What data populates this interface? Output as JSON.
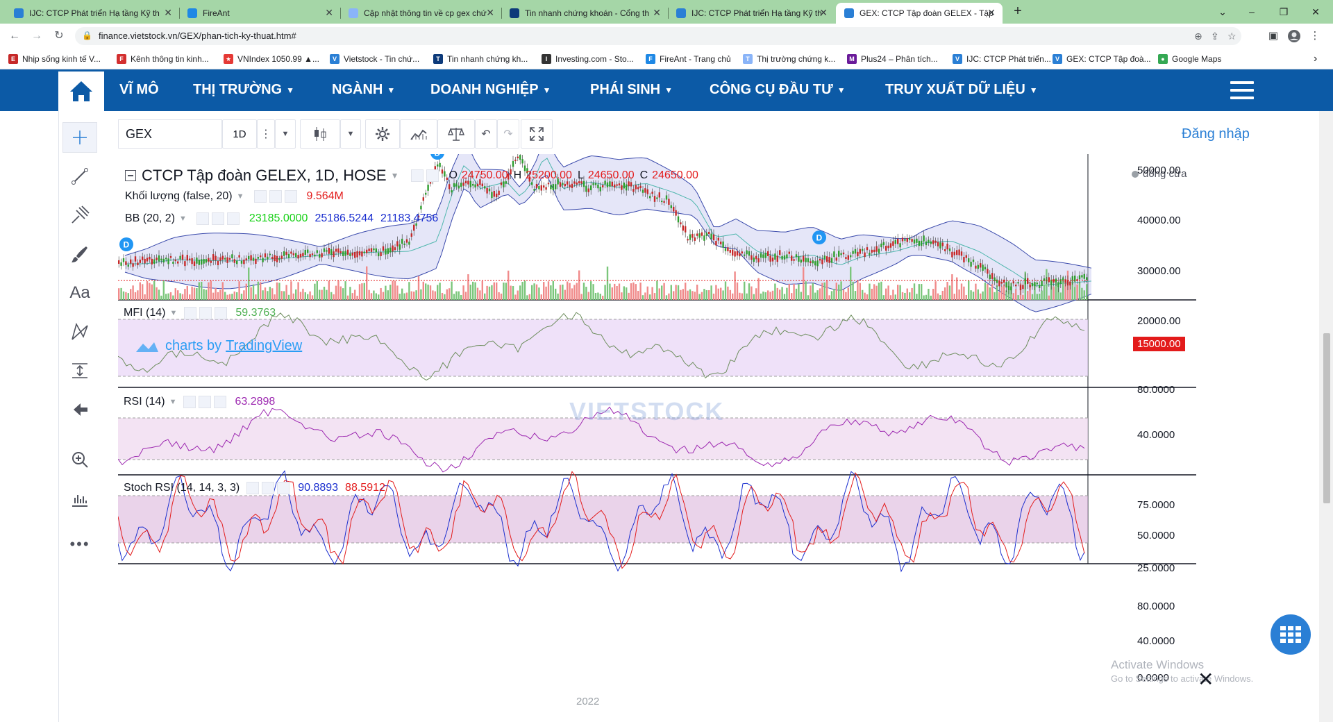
{
  "browser": {
    "tabs": [
      {
        "title": "IJC: CTCP Phát triển Hạ tầng Kỹ th",
        "active": false,
        "icon": "vietstock-icon"
      },
      {
        "title": "FireAnt",
        "active": false,
        "icon": "fireant-icon"
      },
      {
        "title": "Cập nhật thông tin về cp gex chứ",
        "active": false,
        "icon": "image-icon"
      },
      {
        "title": "Tin nhanh chứng khoán - Cổng th",
        "active": false,
        "icon": "tinnhanh-icon"
      },
      {
        "title": "IJC: CTCP Phát triển Hạ tầng Kỹ th",
        "active": false,
        "icon": "vietstock-icon"
      },
      {
        "title": "GEX: CTCP Tập đoàn GELEX - Tập",
        "active": true,
        "icon": "vietstock-icon"
      }
    ],
    "url": "finance.vietstock.vn/GEX/phan-tich-ky-thuat.htm#",
    "bookmarks": [
      "Nhịp sống kinh tế V...",
      "Kênh thông tin kinh...",
      "VNIndex 1050.99 ▲...",
      "Vietstock - Tin chứ...",
      "Tin nhanh chứng kh...",
      "Investing.com - Sto...",
      "FireAnt - Trang chủ",
      "Thị trường chứng k...",
      "Plus24 – Phân tích...",
      "IJC: CTCP Phát triển...",
      "GEX: CTCP Tập đoà...",
      "Google Maps"
    ],
    "colors": {
      "tabbar": "#a5d6a7",
      "site_nav": "#0c5aa6",
      "accent": "#2a7fd5"
    }
  },
  "site_nav": {
    "items": [
      "VĨ MÔ",
      "THỊ TRƯỜNG",
      "NGÀNH",
      "DOANH NGHIỆP",
      "PHÁI SINH",
      "CÔNG CỤ ĐẦU TƯ",
      "TRUY XUẤT DỮ LIỆU"
    ]
  },
  "toolbar": {
    "symbol": "GEX",
    "interval": "1D",
    "login": "Đăng nhập"
  },
  "main_panel": {
    "title": "CTCP Tập đoàn GELEX, 1D, HOSE",
    "ohlc": {
      "o_label": "O",
      "o": "24750.00",
      "h_label": "H",
      "h": "25200.00",
      "l_label": "L",
      "l": "24650.00",
      "c_label": "C",
      "c": "24650.00"
    },
    "volume_label": "Khối lượng (false, 20)",
    "volume_value": "9.564M",
    "bb_label": "BB (20, 2)",
    "bb_values": [
      "23185.0000",
      "25186.5244",
      "21183.4756"
    ],
    "status": "đóng cửa",
    "price_axis": [
      "50000.00",
      "40000.00",
      "30000.00",
      "20000.00"
    ],
    "price_tag": "15000.00",
    "watermark": "charts by",
    "watermark_link": "TradingView"
  },
  "mfi_panel": {
    "label": "MFI (14)",
    "value": "59.3763",
    "axis": [
      "80.0000",
      "40.0000"
    ]
  },
  "rsi_panel": {
    "label": "RSI (14)",
    "value": "63.2898",
    "axis": [
      "75.0000",
      "50.0000",
      "25.0000"
    ]
  },
  "stoch_panel": {
    "label": "Stoch RSI (14, 14, 3, 3)",
    "values": [
      "90.8893",
      "88.5912"
    ],
    "axis": [
      "80.0000",
      "40.0000",
      "0.0000"
    ]
  },
  "time_axis": {
    "label_year": "2022"
  },
  "overlay": {
    "activate": "Activate Windows",
    "activate_sub": "Go to Settings to activate Windows."
  },
  "logo_text": "VIETSTOCK"
}
